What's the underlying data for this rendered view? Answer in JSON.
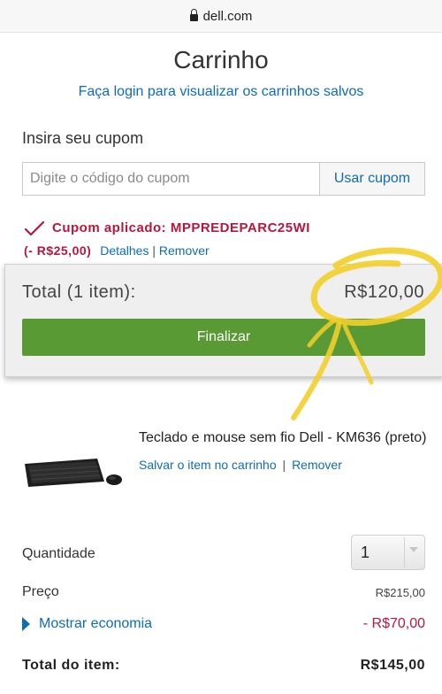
{
  "browser": {
    "domain": "dell.com"
  },
  "page": {
    "title": "Carrinho",
    "login_link": "Faça login para visualizar os carrinhos salvos"
  },
  "coupon": {
    "label": "Insira seu cupom",
    "placeholder": "Digite o código do cupom",
    "button": "Usar cupom",
    "applied_text": "Cupom aplicado: MPPREDEPARC25WI",
    "discount": "(- R$25,00)",
    "details_link": "Detalhes",
    "separator": "|",
    "remove_link": "Remover"
  },
  "summary": {
    "total_label": "Total (1 item):",
    "total_value": "R$120,00",
    "checkout_button": "Finalizar"
  },
  "item": {
    "name": "Teclado e mouse sem fio Dell - KM636 (preto)",
    "save_link": "Salvar o item no carrinho",
    "separator": "|",
    "remove_link": "Remover",
    "image_icon": "keyboard-mouse-image",
    "quantity_label": "Quantidade",
    "quantity_value": "1",
    "price_label": "Preço",
    "price_value": "R$215,00",
    "savings_link": "Mostrar economia",
    "savings_value": "- R$70,00",
    "item_total_label": "Total do item:",
    "item_total_value": "R$145,00"
  },
  "colors": {
    "link": "#0f6cb6",
    "coupon_red": "#b5183d",
    "checkout_green": "#5a9a35",
    "annotation_yellow": "#f2cf2a"
  }
}
